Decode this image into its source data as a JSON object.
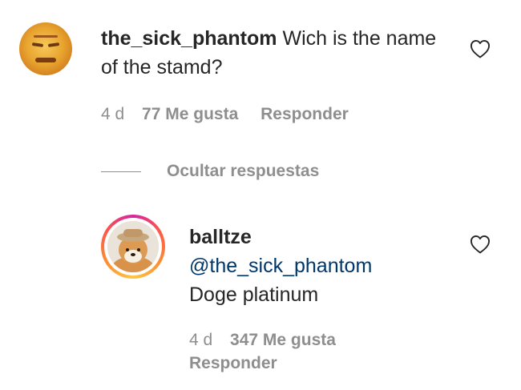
{
  "comment": {
    "username": "the_sick_phantom",
    "text": "Wich is the name of the stamd?",
    "time": "4 d",
    "likes": "77 Me gusta",
    "reply_label": "Responder"
  },
  "hide_replies_label": "Ocultar respuestas",
  "reply": {
    "username": "balltze",
    "mention": "@the_sick_phantom",
    "text": "Doge platinum",
    "time": "4 d",
    "likes": "347 Me gusta",
    "reply_label": "Responder"
  },
  "icons": {
    "like": "heart-outline-icon"
  },
  "colors": {
    "text": "#262626",
    "muted": "#8e8e8e",
    "mention": "#00376b",
    "story_ring_start": "#d6249f",
    "story_ring_end": "#fdc745"
  }
}
